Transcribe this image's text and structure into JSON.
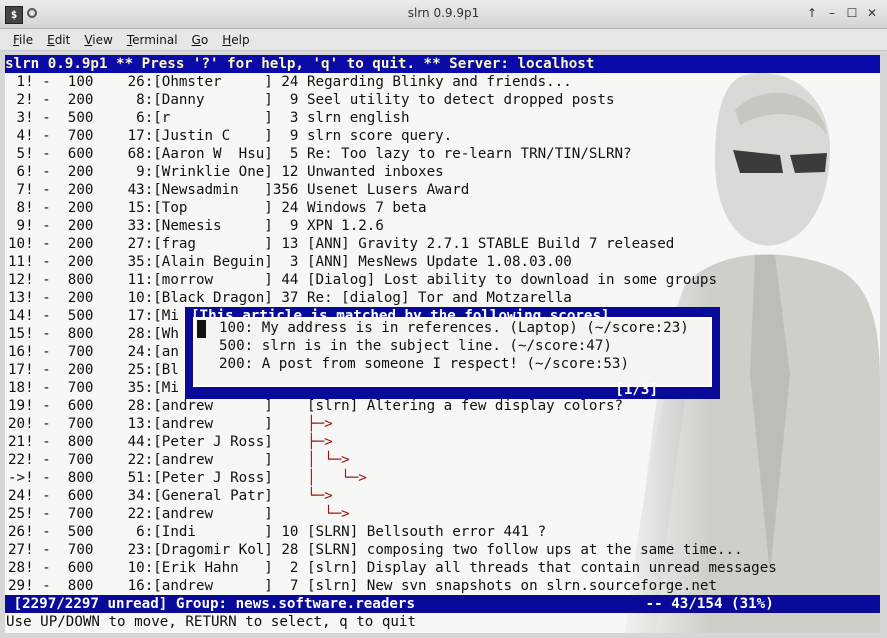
{
  "window": {
    "title": "slrn 0.9.9p1",
    "icon_glyph": "$",
    "controls": [
      "↑",
      "–",
      "☐",
      "✕"
    ]
  },
  "menu": [
    "File",
    "Edit",
    "View",
    "Terminal",
    "Go",
    "Help"
  ],
  "status_top": "slrn 0.9.9p1 ** Press '?' for help, 'q' to quit. ** Server: localhost",
  "articles": [
    {
      "num": " 1",
      "flag": "!",
      "score": " 100",
      "lines": "26",
      "author": "Ohmster     ",
      "count": " 24",
      "subject": " Regarding Blinky and friends..."
    },
    {
      "num": " 2",
      "flag": "!",
      "score": " 200",
      "lines": " 8",
      "author": "Danny       ",
      "count": "  9",
      "subject": " Seel utility to detect dropped posts"
    },
    {
      "num": " 3",
      "flag": "!",
      "score": " 500",
      "lines": " 6",
      "author": "r           ",
      "count": "  3",
      "subject": " slrn english"
    },
    {
      "num": " 4",
      "flag": "!",
      "score": " 700",
      "lines": "17",
      "author": "Justin C    ",
      "count": "  9",
      "subject": " slrn score query."
    },
    {
      "num": " 5",
      "flag": "!",
      "score": " 600",
      "lines": "68",
      "author": "Aaron W  Hsu",
      "count": "  5",
      "subject": " Re: Too lazy to re-learn TRN/TIN/SLRN?"
    },
    {
      "num": " 6",
      "flag": "!",
      "score": " 200",
      "lines": " 9",
      "author": "Wrinklie One",
      "count": " 12",
      "subject": " Unwanted inboxes"
    },
    {
      "num": " 7",
      "flag": "!",
      "score": " 200",
      "lines": "43",
      "author": "Newsadmin   ",
      "count": "356",
      "subject": " Usenet Lusers Award"
    },
    {
      "num": " 8",
      "flag": "!",
      "score": " 200",
      "lines": "15",
      "author": "Top         ",
      "count": " 24",
      "subject": " Windows 7 beta"
    },
    {
      "num": " 9",
      "flag": "!",
      "score": " 200",
      "lines": "33",
      "author": "Nemesis     ",
      "count": "  9",
      "subject": " XPN 1.2.6"
    },
    {
      "num": "10",
      "flag": "!",
      "score": " 200",
      "lines": "27",
      "author": "frag        ",
      "count": " 13",
      "subject": " [ANN] Gravity 2.7.1 STABLE Build 7 released"
    },
    {
      "num": "11",
      "flag": "!",
      "score": " 200",
      "lines": "35",
      "author": "Alain Beguin",
      "count": "  3",
      "subject": " [ANN] MesNews Update 1.08.03.00"
    },
    {
      "num": "12",
      "flag": "!",
      "score": " 800",
      "lines": "11",
      "author": "morrow      ",
      "count": " 44",
      "subject": " [Dialog] Lost ability to download in some groups"
    },
    {
      "num": "13",
      "flag": "!",
      "score": " 200",
      "lines": "10",
      "author": "Black Dragon",
      "count": " 37",
      "subject": " Re: [dialog] Tor and Motzarella"
    },
    {
      "num": "14",
      "flag": "!",
      "score": " 500",
      "lines": "17",
      "author": "Mi",
      "count": "",
      "subject": ""
    },
    {
      "num": "15",
      "flag": "!",
      "score": " 800",
      "lines": "28",
      "author": "Wh",
      "count": "",
      "subject": ""
    },
    {
      "num": "16",
      "flag": "!",
      "score": " 700",
      "lines": "24",
      "author": "an",
      "count": "",
      "subject": ""
    },
    {
      "num": "17",
      "flag": "!",
      "score": " 200",
      "lines": "25",
      "author": "Bl",
      "count": "",
      "subject": ""
    },
    {
      "num": "18",
      "flag": "!",
      "score": " 700",
      "lines": "35",
      "author": "Mi",
      "count": "",
      "subject": ""
    },
    {
      "num": "19",
      "flag": "!",
      "score": " 600",
      "lines": "28",
      "author": "andrew      ",
      "count": "   ",
      "subject": " [slrn] Altering a few display colors?"
    },
    {
      "num": "20",
      "flag": "!",
      "score": " 700",
      "lines": "13",
      "author": "andrew      ",
      "count": "   ",
      "subject": "",
      "tree": " ├─>"
    },
    {
      "num": "21",
      "flag": "!",
      "score": " 800",
      "lines": "44",
      "author": "Peter J Ross",
      "count": "   ",
      "subject": "",
      "tree": " ├─>"
    },
    {
      "num": "22",
      "flag": "!",
      "score": " 700",
      "lines": "22",
      "author": "andrew      ",
      "count": "   ",
      "subject": "",
      "tree": " │ └─>"
    },
    {
      "num": "->",
      "flag": "!",
      "score": " 800",
      "lines": "51",
      "author": "Peter J Ross",
      "count": "   ",
      "subject": "",
      "tree": " │   └─>"
    },
    {
      "num": "24",
      "flag": "!",
      "score": " 600",
      "lines": "34",
      "author": "General Patr",
      "count": "   ",
      "subject": "",
      "tree": " └─>"
    },
    {
      "num": "25",
      "flag": "!",
      "score": " 700",
      "lines": "22",
      "author": "andrew      ",
      "count": "   ",
      "subject": "",
      "tree": "   └─>"
    },
    {
      "num": "26",
      "flag": "!",
      "score": " 500",
      "lines": " 6",
      "author": "Indi        ",
      "count": " 10",
      "subject": " [SLRN] Bellsouth error 441 ?"
    },
    {
      "num": "27",
      "flag": "!",
      "score": " 700",
      "lines": "23",
      "author": "Dragomir Kol",
      "count": " 28",
      "subject": " [SLRN] composing two follow ups at the same time..."
    },
    {
      "num": "28",
      "flag": "!",
      "score": " 600",
      "lines": "10",
      "author": "Erik Hahn   ",
      "count": "  2",
      "subject": " [slrn] Display all threads that contain unread messages"
    },
    {
      "num": "29",
      "flag": "!",
      "score": " 800",
      "lines": "16",
      "author": "andrew      ",
      "count": "  7",
      "subject": " [slrn] New svn snapshots on slrn.sourceforge.net"
    }
  ],
  "popup": {
    "title": "[This article is matched by the following scores]",
    "lines": [
      "100: My address is in references. (Laptop) (~/score:23)",
      "500: slrn is in the subject line. (~/score:47)",
      "200: A post from someone I respect! (~/score:53)"
    ],
    "page": "[1/3]"
  },
  "status_bottom": " [2297/2297 unread] Group: news.software.readers                           -- 43/154 (31%)",
  "help_line": "Use UP/DOWN to move, RETURN to select, q to quit"
}
